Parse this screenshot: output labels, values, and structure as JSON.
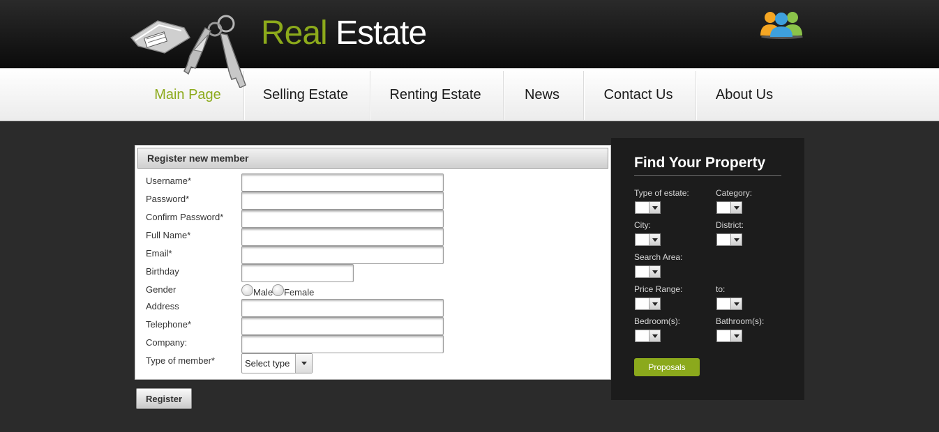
{
  "header": {
    "logo_word_1": "Real",
    "logo_word_2": "Estate",
    "brand_color": "#8caa1b",
    "users_icon": "users-group-icon",
    "keys_icon": "house-keys-icon"
  },
  "nav": {
    "items": [
      {
        "label": "Main Page",
        "active": true
      },
      {
        "label": "Selling Estate",
        "active": false
      },
      {
        "label": "Renting Estate",
        "active": false
      },
      {
        "label": "News",
        "active": false
      },
      {
        "label": "Contact Us",
        "active": false
      },
      {
        "label": "About Us",
        "active": false
      }
    ]
  },
  "register": {
    "title": "Register new member",
    "username_label": "Username*",
    "password_label": "Password*",
    "confirm_password_label": "Confirm Password*",
    "full_name_label": "Full Name*",
    "email_label": "Email*",
    "birthday_label": "Birthday",
    "gender_label": "Gender",
    "gender_male": "Male",
    "gender_female": "Female",
    "address_label": "Address",
    "telephone_label": "Telephone*",
    "company_label": "Company:",
    "member_type_label": "Type of member*",
    "member_type_value": "Select type",
    "submit_label": "Register"
  },
  "search": {
    "title": "Find Your Property",
    "type_of_estate_label": "Type of estate:",
    "category_label": "Category:",
    "city_label": "City:",
    "district_label": "District:",
    "search_area_label": "Search Area:",
    "price_range_label": "Price Range:",
    "to_label": "to:",
    "bedrooms_label": "Bedroom(s):",
    "bathrooms_label": "Bathroom(s):",
    "proposals_label": "Proposals",
    "accent_color": "#8ba91c"
  }
}
